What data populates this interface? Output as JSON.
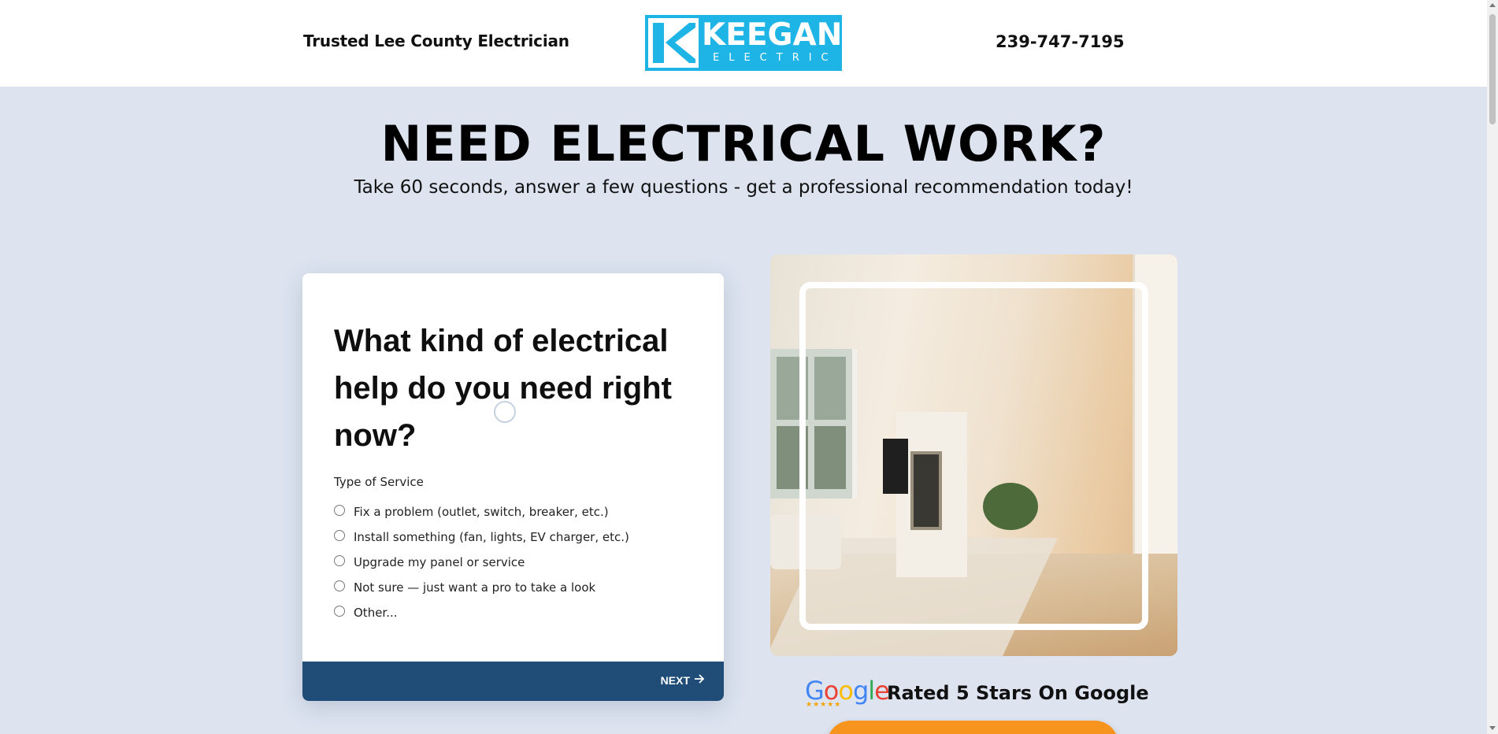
{
  "header": {
    "tagline": "Trusted Lee County Electrician",
    "logo": {
      "word": "KEEGAN",
      "sub": "ELECTRIC"
    },
    "phone": "239-747-7195"
  },
  "hero": {
    "title": "NEED ELECTRICAL WORK?",
    "subtitle": "Take 60 seconds, answer a few questions - get a professional recommendation today!"
  },
  "form": {
    "question": "What kind of electrical help do you need right now?",
    "group_label": "Type of Service",
    "options": [
      "Fix a problem (outlet, switch, breaker, etc.)",
      "Install something (fan, lights, EV charger, etc.)",
      "Upgrade my panel or service",
      "Not sure — just want a pro to take a look",
      "Other..."
    ],
    "next_label": "NEXT"
  },
  "google": {
    "logo_text": "Google",
    "stars": "★★★★★",
    "rated_text": "Rated 5 Stars On Google"
  },
  "colors": {
    "page_bg": "#dde4f0",
    "logo_bg": "#1fb4e6",
    "footer_bar": "#1f4d77",
    "cta": "#f7941d"
  }
}
